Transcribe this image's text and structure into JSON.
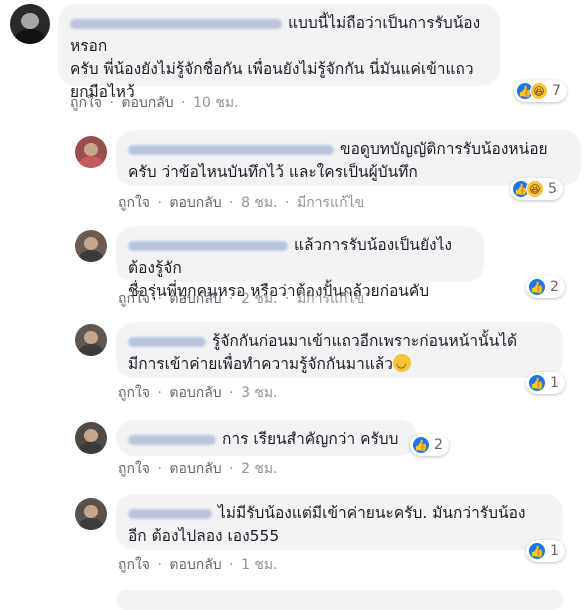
{
  "actions": {
    "like": "ถูกใจ",
    "reply": "ตอบกลับ",
    "edited": "มีการแก้ไข",
    "separator": "·"
  },
  "comments": [
    {
      "text_line1": "แบบนี้ไม่ถือว่าเป็นการรับน้องหรอก",
      "text_line2": "ครับ พี่น้องยังไม่รู้จักชื่อกัน เพื่อนยังไม่รู้จักกัน นี่มันแค่เข้าแถว",
      "text_line3": "ยกมือไหว้",
      "time": "10 ชม.",
      "reaction_count": "7",
      "reaction_icons": [
        "like-icon",
        "haha-icon"
      ]
    },
    {
      "text_line1": "ขอดูบทบัญญัติการรับน้องหน่อย",
      "text_line2": "ครับ ว่าข้อไหนบันทึกไว้ และใครเป็นผู้บันทึก",
      "time": "8 ชม.",
      "edited": true,
      "reaction_count": "5",
      "reaction_icons": [
        "like-icon",
        "haha-icon"
      ]
    },
    {
      "text_line1": "แล้วการรับน้องเป็นยังไง ต้องรู้จัก",
      "text_line2": "ชื่อรุ่นพี่ทุกคนหรอ หรือว่าต้องปั้นกล้วยก่อนคับ",
      "time": "2 ชม.",
      "edited": true,
      "reaction_count": "2",
      "reaction_icons": [
        "like-icon"
      ]
    },
    {
      "text_line1": "รู้จักกันก่อนมาเข้าแถวอีกเพราะก่อนหน้านั้นได้",
      "text_line2": "มีการเข้าค่ายเพื่อทำความรู้จักกันมาแล้ว",
      "emoji": "smiling-face-emoji",
      "time": "3 ชม.",
      "reaction_count": "1",
      "reaction_icons": [
        "like-icon"
      ]
    },
    {
      "text_line1": "การ เรียนสำคัญกว่า ครับบ",
      "time": "2 ชม.",
      "reaction_count": "2",
      "reaction_icons": [
        "like-icon"
      ]
    },
    {
      "text_line1": "ไม่มีรับน้องแต่มีเข้าค่ายนะครับ. มันกว่ารับน้อง",
      "text_line2": "อีก ต้องไปลอง เอง555",
      "time": "1 ชม.",
      "reaction_count": "1",
      "reaction_icons": [
        "like-icon"
      ]
    }
  ]
}
